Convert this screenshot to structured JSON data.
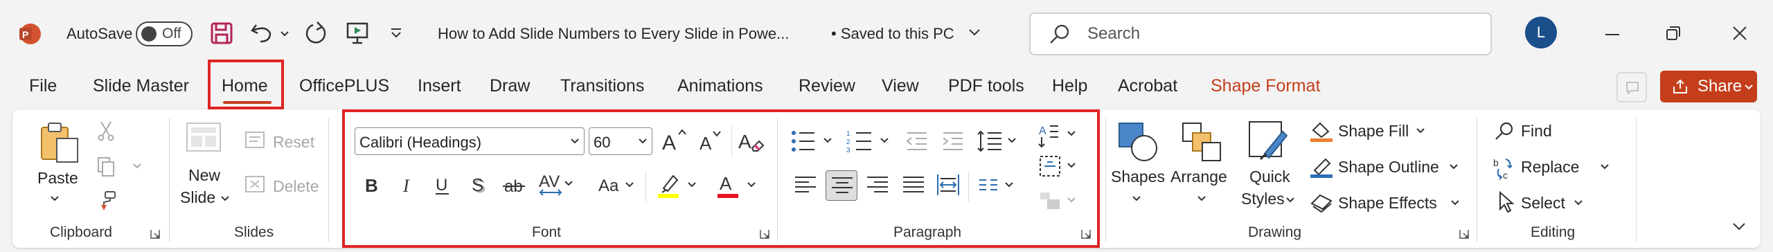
{
  "titlebar": {
    "app_icon": "powerpoint-icon",
    "autosave_label": "AutoSave",
    "autosave_state": "Off",
    "doc_title": "How to Add Slide Numbers to Every Slide in Powe...",
    "save_status": "• Saved to this PC",
    "search_placeholder": "Search",
    "avatar_initial": "L"
  },
  "tabs": [
    {
      "label": "File"
    },
    {
      "label": "Slide Master"
    },
    {
      "label": "Home",
      "active": true
    },
    {
      "label": "OfficePLUS"
    },
    {
      "label": "Insert"
    },
    {
      "label": "Draw"
    },
    {
      "label": "Transitions"
    },
    {
      "label": "Animations"
    },
    {
      "label": "Review"
    },
    {
      "label": "View"
    },
    {
      "label": "PDF tools"
    },
    {
      "label": "Help"
    },
    {
      "label": "Acrobat"
    },
    {
      "label": "Shape Format",
      "contextual": true
    }
  ],
  "share_label": "Share",
  "ribbon": {
    "clipboard": {
      "paste": "Paste",
      "group": "Clipboard"
    },
    "slides": {
      "new_slide_1": "New",
      "new_slide_2": "Slide",
      "reset": "Reset",
      "delete": "Delete",
      "group": "Slides"
    },
    "font": {
      "font_name": "Calibri (Headings)",
      "font_size": "60",
      "group": "Font"
    },
    "paragraph": {
      "group": "Paragraph"
    },
    "drawing": {
      "shapes": "Shapes",
      "arrange": "Arrange",
      "quick_1": "Quick",
      "quick_2": "Styles",
      "shape_fill": "Shape Fill",
      "shape_outline": "Shape Outline",
      "shape_effects": "Shape Effects",
      "group": "Drawing"
    },
    "editing": {
      "find": "Find",
      "replace": "Replace",
      "select": "Select",
      "group": "Editing"
    }
  },
  "colors": {
    "accent": "#c43e1c",
    "highlight": "#ffff00",
    "font_color": "#e81123",
    "annotation": "#e02424"
  }
}
